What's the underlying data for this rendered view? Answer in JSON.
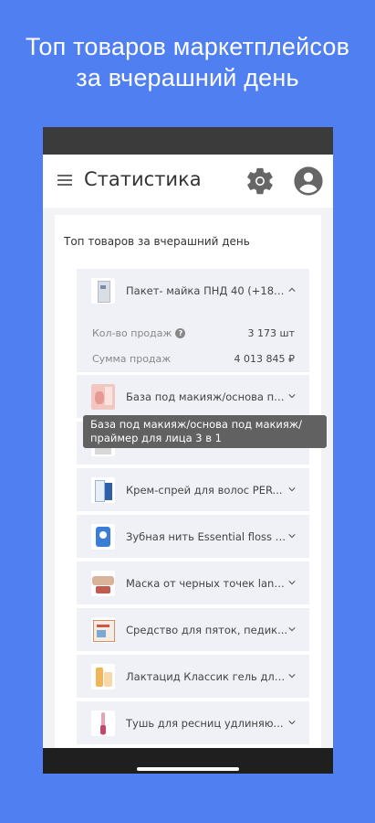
{
  "promo": {
    "line1": "Топ товаров маркетплейсов",
    "line2": "за вчерашний день"
  },
  "app": {
    "title": "Статистика",
    "icons": [
      "menu-icon",
      "gear-icon",
      "account-icon"
    ]
  },
  "card": {
    "title": "Топ товаров за вчерашний день",
    "items": [
      {
        "name": "Пакет- майка ПНД 40 (+18)х...",
        "expanded": true,
        "stats": [
          {
            "label": "Кол-во продаж",
            "value": "3 173 шт"
          },
          {
            "label": "Сумма продаж",
            "value": "4 013 845 ₽"
          }
        ]
      },
      {
        "name": "База под макияж/основа по...",
        "expanded": false
      },
      {
        "name": "",
        "expanded": false
      },
      {
        "name": "Крем-спрей для волос PER...",
        "expanded": false
      },
      {
        "name": "Зубная нить Essential floss м...",
        "expanded": false
      },
      {
        "name": "Маска от черных точек lanb...",
        "expanded": false
      },
      {
        "name": "Средство для пяток, педик...",
        "expanded": false
      },
      {
        "name": "Лактацид Классик гель для ...",
        "expanded": false
      },
      {
        "name": "Тушь для ресниц удлиняю...",
        "expanded": false
      }
    ]
  },
  "tooltip": {
    "text": "База под макияж/основа под макияж/ праймер для лица 3 в 1"
  },
  "colors": {
    "background": "#4f7ff0",
    "status_bar": "#3b3b3b",
    "item_bg": "#eff1f7",
    "tooltip_bg": "#616161",
    "nav_bar": "#1f1f1f"
  }
}
